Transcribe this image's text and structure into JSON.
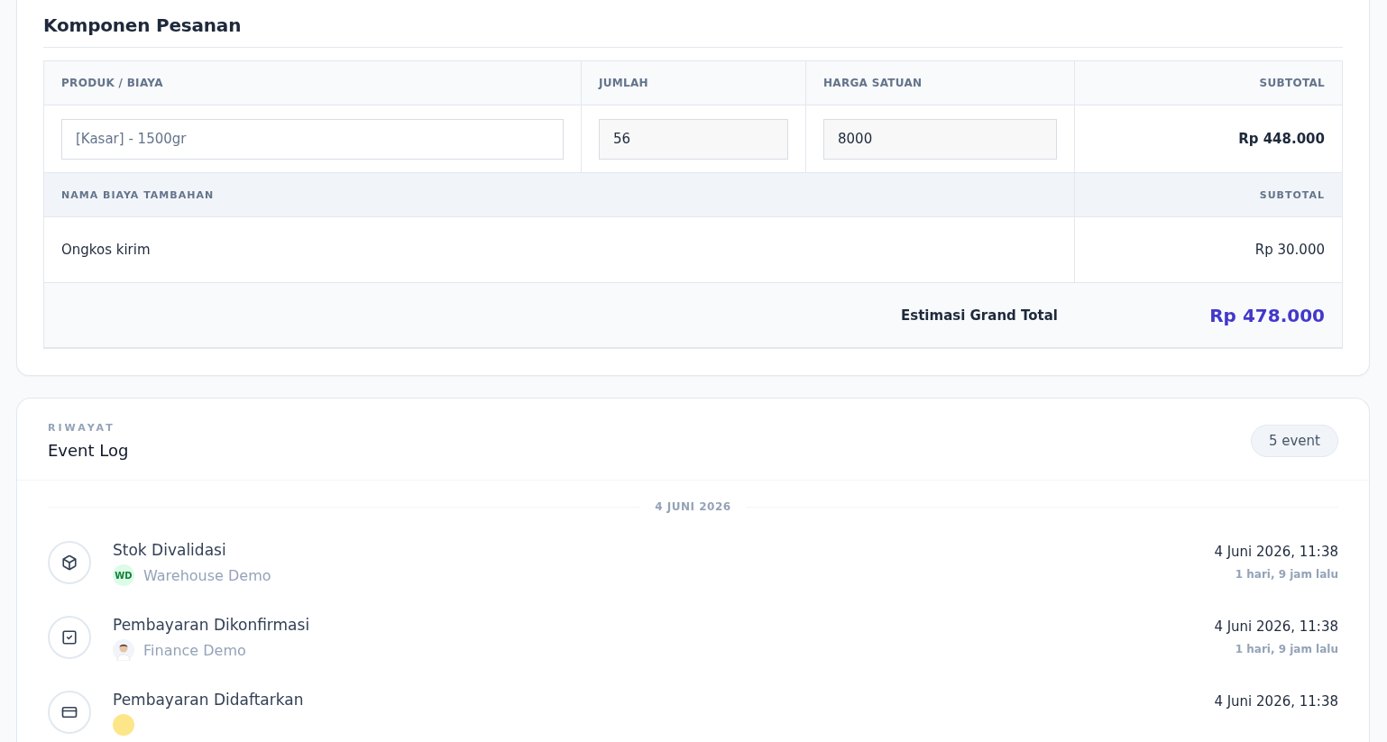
{
  "order_components": {
    "title": "Komponen Pesanan",
    "columns": [
      "PRODUK / BIAYA",
      "JUMLAH",
      "HARGA SATUAN",
      "SUBTOTAL"
    ],
    "items": [
      {
        "product": "[Kasar] - 1500gr",
        "quantity": "56",
        "unit_price": "8000",
        "subtotal": "Rp 448.000"
      }
    ],
    "extra_columns": [
      "NAMA BIAYA TAMBAHAN",
      "SUBTOTAL"
    ],
    "extras": [
      {
        "name": "Ongkos kirim",
        "subtotal": "Rp 30.000"
      }
    ],
    "total_label": "Estimasi Grand Total",
    "total_value": "Rp 478.000"
  },
  "event_log": {
    "eyebrow": "RIWAYAT",
    "title": "Event Log",
    "count": "5 event",
    "groups": [
      {
        "date": "4 JUNI 2026",
        "events": [
          {
            "kind": "box",
            "title": "Stok Divalidasi",
            "actor": {
              "kind": "initials",
              "initials": "WD",
              "name": "Warehouse Demo"
            },
            "time": "4 Juni 2026, 11:38",
            "ago": "1 hari, 9 jam lalu"
          },
          {
            "kind": "check",
            "title": "Pembayaran Dikonfirmasi",
            "actor": {
              "kind": "photo",
              "name": "Finance Demo"
            },
            "time": "4 Juni 2026, 11:38",
            "ago": "1 hari, 9 jam lalu"
          },
          {
            "kind": "card",
            "title": "Pembayaran Didaftarkan",
            "actor": {
              "kind": "cut"
            },
            "time": "4 Juni 2026, 11:38"
          }
        ]
      }
    ]
  }
}
